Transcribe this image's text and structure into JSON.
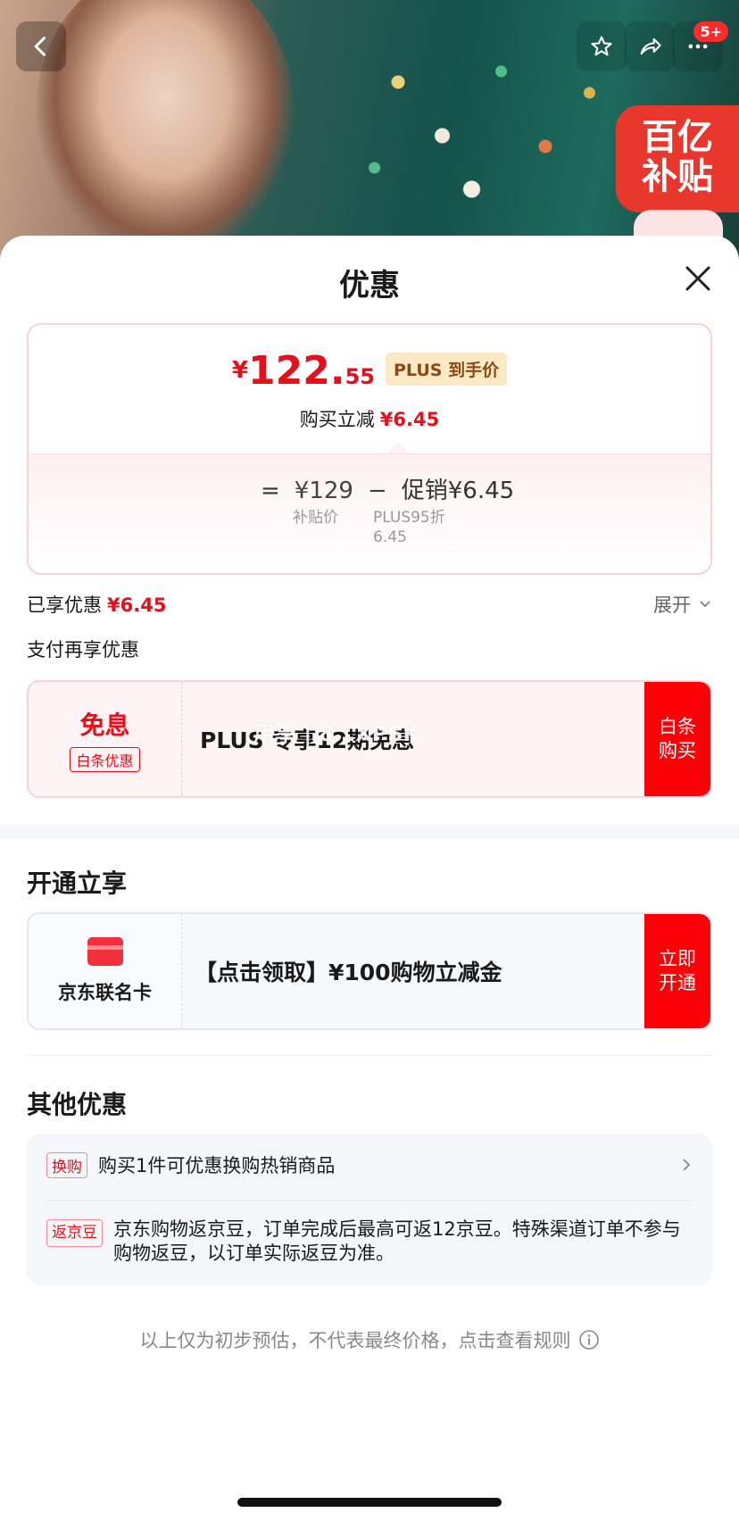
{
  "background": {
    "subsidy_line1": "百亿",
    "subsidy_line2": "补贴",
    "badge": "5+"
  },
  "sheet": {
    "title": "优惠"
  },
  "price_card": {
    "yen": "¥",
    "price_int": "122.",
    "price_dec": "55",
    "plus_tag": "PLUS 到手价",
    "reduce_label": "购买立减",
    "reduce_value": "¥6.45",
    "equals": "=",
    "base_price": "¥129",
    "minus": "−",
    "promo_label": "促销¥6.45",
    "base_sub": "补贴价",
    "promo_sub1": "PLUS95折",
    "promo_sub2": "6.45"
  },
  "enjoyed": {
    "label": "已享优惠",
    "value": "¥6.45",
    "expand": "展开"
  },
  "pay_title": "支付再享优惠",
  "baitiao": {
    "big": "免息",
    "tag": "白条优惠",
    "desc": "PLUS 专享12期免息",
    "watermark": "用享 | 8…XPSK",
    "button_line1": "白条",
    "button_line2": "购买"
  },
  "open_title": "开通立享",
  "jd_card": {
    "name": "京东联名卡",
    "desc": "【点击领取】¥100购物立减金",
    "button_line1": "立即",
    "button_line2": "开通"
  },
  "other": {
    "title": "其他优惠",
    "row1_tag": "换购",
    "row1_text": "购买1件可优惠换购热销商品",
    "row2_tag": "返京豆",
    "row2_text": "京东购物返京豆，订单完成后最高可返12京豆。特殊渠道订单不参与购物返豆，以订单实际返豆为准。"
  },
  "disclaimer": "以上仅为初步预估，不代表最终价格，点击查看规则",
  "colors": {
    "accent_red": "#e4101c",
    "button_red": "#fb0006",
    "plus_gold": "#fbe9c6"
  },
  "icons": [
    "back-icon",
    "star-icon",
    "share-icon",
    "more-icon",
    "close-icon",
    "chevron-down-icon",
    "card-icon",
    "chevron-right-icon",
    "info-icon"
  ]
}
